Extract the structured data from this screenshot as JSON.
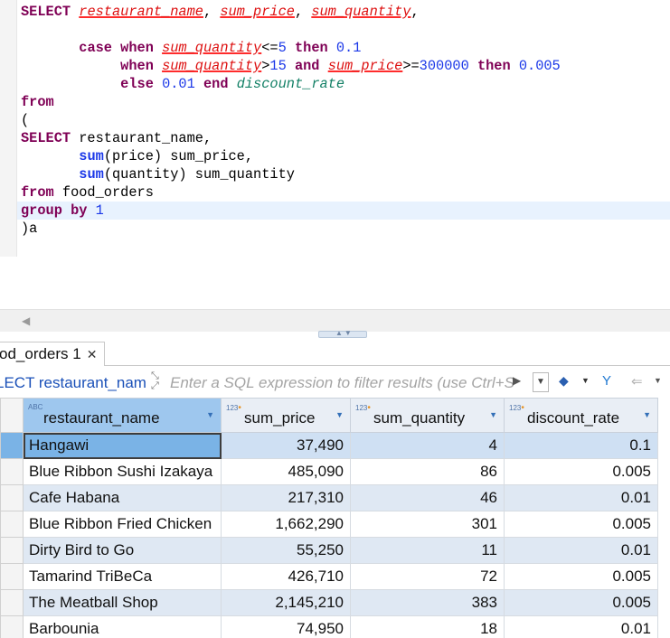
{
  "editor": {
    "gutter_rows": 14
  },
  "results": {
    "tab_label": "od_orders 1",
    "filter_sql": "LECT restaurant_nam",
    "filter_placeholder": "Enter a SQL expression to filter results (use Ctrl+Space)",
    "columns": [
      {
        "name": "restaurant_name",
        "type_icon": "ABC"
      },
      {
        "name": "sum_price",
        "type_icon": "123"
      },
      {
        "name": "sum_quantity",
        "type_icon": "123"
      },
      {
        "name": "discount_rate",
        "type_icon": "123"
      }
    ],
    "rows": [
      [
        "Hangawi",
        "37,490",
        "4",
        "0.1"
      ],
      [
        "Blue Ribbon Sushi Izakaya",
        "485,090",
        "86",
        "0.005"
      ],
      [
        "Cafe Habana",
        "217,310",
        "46",
        "0.01"
      ],
      [
        "Blue Ribbon Fried Chicken",
        "1,662,290",
        "301",
        "0.005"
      ],
      [
        "Dirty Bird to Go",
        "55,250",
        "11",
        "0.01"
      ],
      [
        "Tamarind TriBeCa",
        "426,710",
        "72",
        "0.005"
      ],
      [
        "The Meatball Shop",
        "2,145,210",
        "383",
        "0.005"
      ],
      [
        "Barbounia",
        "74,950",
        "18",
        "0.01"
      ]
    ]
  },
  "colors": {
    "keyword": "#7f0055",
    "number": "#1a37e8",
    "error": "#dd1111",
    "alias": "#138066",
    "selection": "#7ab3e6",
    "alt_row": "#dfe8f3"
  },
  "icons": {
    "tab_close": "close-icon",
    "eraser": "eraser-icon",
    "filter": "filter-icon",
    "back": "back-arrow-icon"
  }
}
